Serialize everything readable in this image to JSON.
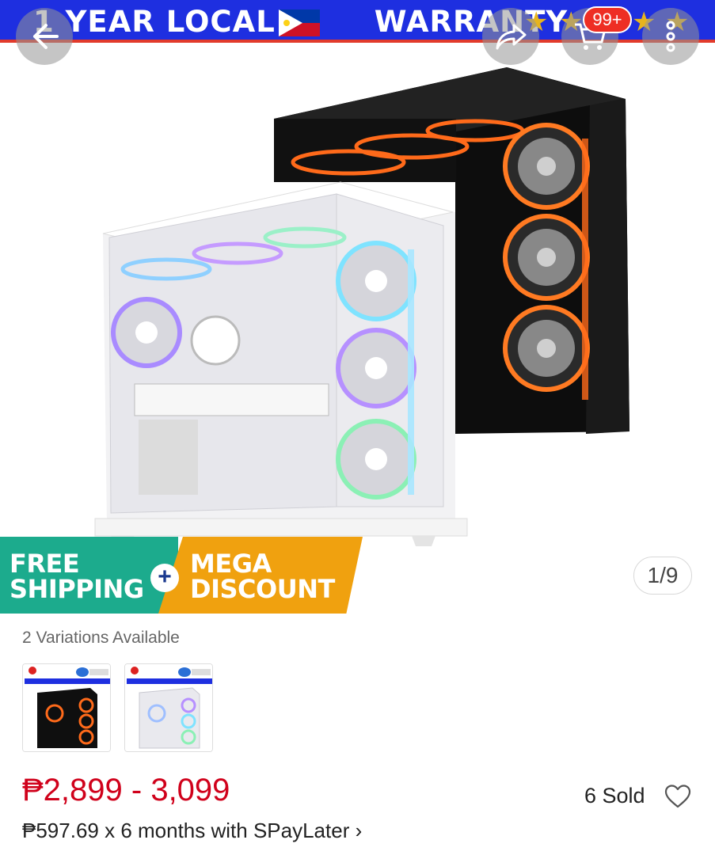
{
  "banner": {
    "warranty_text": "1 YEAR LOCAL         WARRANTY"
  },
  "toolbar": {
    "back_icon": "back-arrow-icon",
    "share_icon": "share-icon",
    "cart_icon": "cart-icon",
    "cart_badge": "99+",
    "more_icon": "more-icon"
  },
  "promo": {
    "free_line1": "FREE",
    "free_line2": "SHIPPING",
    "plus": "+",
    "mega_line1": "MEGA",
    "mega_line2": "DISCOUNT"
  },
  "gallery": {
    "counter": "1/9"
  },
  "variations": {
    "label": "2 Variations Available"
  },
  "product": {
    "price": "₱2,899 - 3,099",
    "sold": "6 Sold",
    "installment_prefix": "₱597.69 x 6 months with ",
    "installment_brand": "SPayLater",
    "installment_chevron": "›"
  },
  "colors": {
    "banner_blue": "#1e2fe0",
    "promo_green": "#1cab8d",
    "promo_orange": "#f0a10f",
    "price_red": "#d0011b",
    "badge_red": "#ee2e24"
  }
}
